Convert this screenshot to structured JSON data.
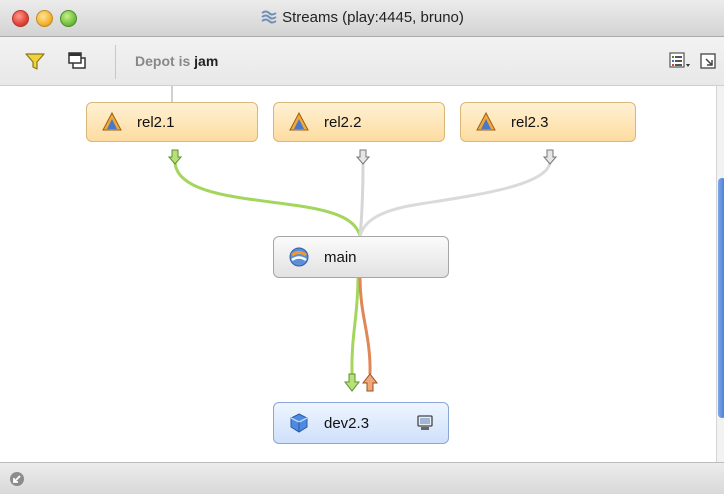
{
  "window": {
    "title": "Streams (play:4445, bruno)",
    "title_icon": "streams-icon"
  },
  "toolbar": {
    "filter_icon": "funnel-icon",
    "window_icon": "windows-icon",
    "filter_label": "Depot",
    "filter_is": "is",
    "filter_value": "jam",
    "view_options_icon": "view-options-icon",
    "panel_icon": "panel-icon"
  },
  "graph": {
    "colors": {
      "merge_down": "#a3d65b",
      "copy_up": "#e08756",
      "idle": "#d0d0d0",
      "rel_fill": "#fddca0",
      "dev_fill": "#cfe0fb",
      "main_fill": "#e2e2e2"
    },
    "streams": [
      {
        "id": "rel2.1",
        "label": "rel2.1",
        "type": "release",
        "icon": "release-stream-icon",
        "status": "merge-down-pending"
      },
      {
        "id": "rel2.2",
        "label": "rel2.2",
        "type": "release",
        "icon": "release-stream-icon",
        "status": "idle"
      },
      {
        "id": "rel2.3",
        "label": "rel2.3",
        "type": "release",
        "icon": "release-stream-icon",
        "status": "idle"
      },
      {
        "id": "main",
        "label": "main",
        "type": "mainline",
        "icon": "mainline-stream-icon"
      },
      {
        "id": "dev2.3",
        "label": "dev2.3",
        "type": "development",
        "icon": "development-stream-icon",
        "workspace_icon": "workspace-icon",
        "status": "merge-down-and-copy-up"
      }
    ]
  },
  "statusbar": {
    "icon": "resize-corner-icon"
  }
}
